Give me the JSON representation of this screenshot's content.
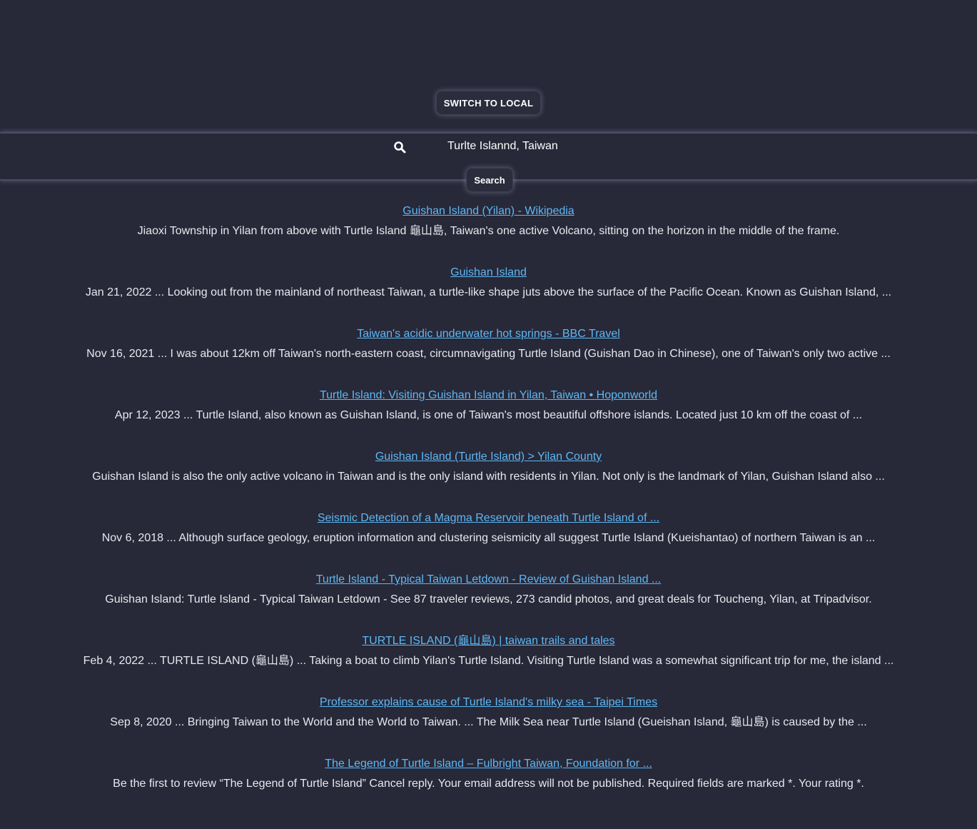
{
  "header": {
    "switch_label": "SWITCH TO LOCAL"
  },
  "search": {
    "icon": "search-icon",
    "query": "Turlte Islannd, Taiwan",
    "button_label": "Search"
  },
  "colors": {
    "background": "#272838",
    "link": "#5eb8f5",
    "text": "#e8e8ee"
  },
  "results": [
    {
      "title": "Guishan Island (Yilan) - Wikipedia",
      "snippet": "Jiaoxi Township in Yilan from above with Turtle Island 龜山島, Taiwan's one active Volcano, sitting on the horizon in the middle of the frame."
    },
    {
      "title": "Guishan Island",
      "snippet": "Jan 21, 2022 ... Looking out from the mainland of northeast Taiwan, a turtle-like shape juts above the surface of the Pacific Ocean. Known as Guishan Island, ..."
    },
    {
      "title": "Taiwan's acidic underwater hot springs - BBC Travel",
      "snippet": "Nov 16, 2021 ... I was about 12km off Taiwan's north-eastern coast, circumnavigating Turtle Island (Guishan Dao in Chinese), one of Taiwan's only two active ..."
    },
    {
      "title": "Turtle Island: Visiting Guishan Island in Yilan, Taiwan • Hoponworld",
      "snippet": "Apr 12, 2023 ... Turtle Island, also known as Guishan Island, is one of Taiwan's most beautiful offshore islands. Located just 10 km off the coast of ..."
    },
    {
      "title": "Guishan Island (Turtle Island) > Yilan County",
      "snippet": "Guishan Island is also the only active volcano in Taiwan and is the only island with residents in Yilan. Not only is the landmark of Yilan, Guishan Island also ..."
    },
    {
      "title": "Seismic Detection of a Magma Reservoir beneath Turtle Island of ...",
      "snippet": "Nov 6, 2018 ... Although surface geology, eruption information and clustering seismicity all suggest Turtle Island (Kueishantao) of northern Taiwan is an ..."
    },
    {
      "title": "Turtle Island - Typical Taiwan Letdown - Review of Guishan Island ...",
      "snippet": "Guishan Island: Turtle Island - Typical Taiwan Letdown - See 87 traveler reviews, 273 candid photos, and great deals for Toucheng, Yilan, at Tripadvisor."
    },
    {
      "title": "TURTLE ISLAND (龜山島) | taiwan trails and tales",
      "snippet": "Feb 4, 2022 ... TURTLE ISLAND (龜山島) ... Taking a boat to climb Yilan's Turtle Island. Visiting Turtle Island was a somewhat significant trip for me, the island ..."
    },
    {
      "title": "Professor explains cause of Turtle Island's milky sea - Taipei Times",
      "snippet": "Sep 8, 2020 ... Bringing Taiwan to the World and the World to Taiwan. ... The Milk Sea near Turtle Island (Gueishan Island, 龜山島) is caused by the ..."
    },
    {
      "title": "The Legend of Turtle Island – Fulbright Taiwan, Foundation for ...",
      "snippet": "Be the first to review “The Legend of Turtle Island” Cancel reply. Your email address will not be published. Required fields are marked *. Your rating *."
    }
  ]
}
